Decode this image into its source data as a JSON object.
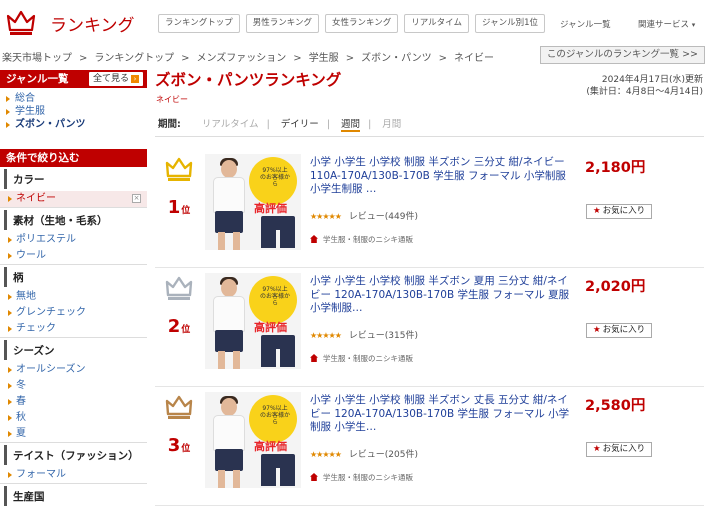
{
  "header": {
    "site_title": "ランキング",
    "nav_buttons": [
      "ランキングトップ",
      "男性ランキング",
      "女性ランキング",
      "リアルタイム",
      "ジャンル別1位"
    ],
    "genre_list_link": "ジャンル一覧",
    "related_services": "関連サービス"
  },
  "breadcrumb": {
    "items": [
      "楽天市場トップ",
      "ランキングトップ",
      "メンズファッション",
      "学生服",
      "ズボン・パンツ",
      "ネイビー"
    ],
    "genre_button": "このジャンルのランキング一覧 >>"
  },
  "sidebar": {
    "genre_header": "ジャンル一覧",
    "show_all": "全て見る",
    "genres": [
      "総合",
      "学生服",
      "ズボン・パンツ"
    ],
    "filter_header": "条件で絞り込む",
    "filters": [
      {
        "title": "カラー",
        "items": [
          "ネイビー"
        ]
      },
      {
        "title": "素材（生地・毛系）",
        "items": [
          "ポリエステル",
          "ウール"
        ]
      },
      {
        "title": "柄",
        "items": [
          "無地",
          "グレンチェック",
          "チェック"
        ]
      },
      {
        "title": "シーズン",
        "items": [
          "オールシーズン",
          "冬",
          "春",
          "秋",
          "夏"
        ]
      },
      {
        "title": "テイスト（ファッション）",
        "items": [
          "フォーマル"
        ]
      },
      {
        "title": "生産国",
        "items": []
      }
    ]
  },
  "main": {
    "title": "ズボン・パンツランキング",
    "subtitle": "ネイビー",
    "updated": "2024年4月17日(水)更新",
    "period_range": "(集計日：4月8日～4月14日)",
    "period_label": "期間:",
    "periods": [
      "リアルタイム",
      "デイリー",
      "週間",
      "月間"
    ],
    "rank_suffix": "位",
    "favorite_label": "お気に入り",
    "review_prefix": "レビュー",
    "shop_name": "学生服・制服のニシキ通販",
    "image_badge": "97%以上のお客様から",
    "image_badge_hi": "高評価",
    "items": [
      {
        "rank": "1",
        "title": "小学 小学生 小学校 制服 半ズボン 三分丈 紺/ネイビー 110A-170A/130B-170B 学生服 フォーマル 小学制服 小学生制服 …",
        "price": "2,180円",
        "reviews": "(449件)",
        "stars": "★★★★★",
        "rating": 4.5,
        "crown_color": "#e6b400"
      },
      {
        "rank": "2",
        "title": "小学 小学生 小学校 制服 半ズボン 夏用 三分丈 紺/ネイビー 120A-170A/130B-170B 学生服 フォーマル 夏服 小学制服…",
        "price": "2,020円",
        "reviews": "(315件)",
        "stars": "★★★★★",
        "rating": 4.5,
        "crown_color": "#aab2bc"
      },
      {
        "rank": "3",
        "title": "小学 小学生 小学校 制服 半ズボン 丈長 五分丈 紺/ネイビー 120A-170A/130B-170B 学生服 フォーマル 小学制服 小学生…",
        "price": "2,580円",
        "reviews": "(205件)",
        "stars": "★★★★★",
        "rating": 4.5,
        "crown_color": "#b8854a"
      }
    ]
  },
  "colors": {
    "accent": "#bf0000",
    "link": "#1f3f99",
    "orange": "#e08800"
  }
}
